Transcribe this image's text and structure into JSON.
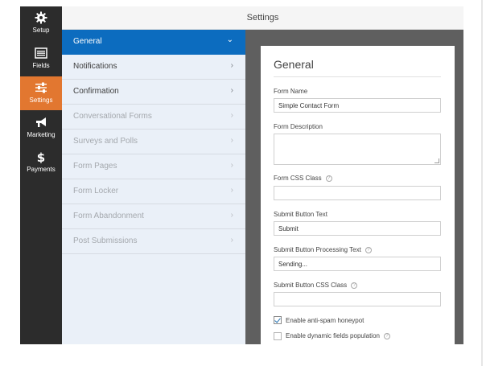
{
  "header": {
    "title": "Settings"
  },
  "leftnav": {
    "items": [
      {
        "label": "Setup",
        "icon": "gear-icon"
      },
      {
        "label": "Fields",
        "icon": "list-icon"
      },
      {
        "label": "Settings",
        "icon": "sliders-icon"
      },
      {
        "label": "Marketing",
        "icon": "megaphone-icon"
      },
      {
        "label": "Payments",
        "icon": "dollar-icon"
      }
    ],
    "active": "Settings"
  },
  "panel": {
    "items": [
      {
        "label": "General"
      },
      {
        "label": "Notifications"
      },
      {
        "label": "Confirmation"
      },
      {
        "label": "Conversational Forms"
      },
      {
        "label": "Surveys and Polls"
      },
      {
        "label": "Form Pages"
      },
      {
        "label": "Form Locker"
      },
      {
        "label": "Form Abandonment"
      },
      {
        "label": "Post Submissions"
      }
    ],
    "active": "General"
  },
  "general": {
    "title": "General",
    "form_name_label": "Form Name",
    "form_name_value": "Simple Contact Form",
    "form_description_label": "Form Description",
    "form_css_class_label": "Form CSS Class",
    "submit_text_label": "Submit Button Text",
    "submit_text_value": "Submit",
    "submit_processing_label": "Submit Button Processing Text",
    "submit_processing_value": "Sending...",
    "submit_css_class_label": "Submit Button CSS Class",
    "honeypot_label": "Enable anti-spam honeypot",
    "honeypot_checked": true,
    "dynamic_fields_label": "Enable dynamic fields population",
    "dynamic_fields_checked": false
  },
  "colors": {
    "accent_orange": "#e27730",
    "active_blue": "#0c6cbf",
    "nav_dark": "#2c2c2c"
  }
}
